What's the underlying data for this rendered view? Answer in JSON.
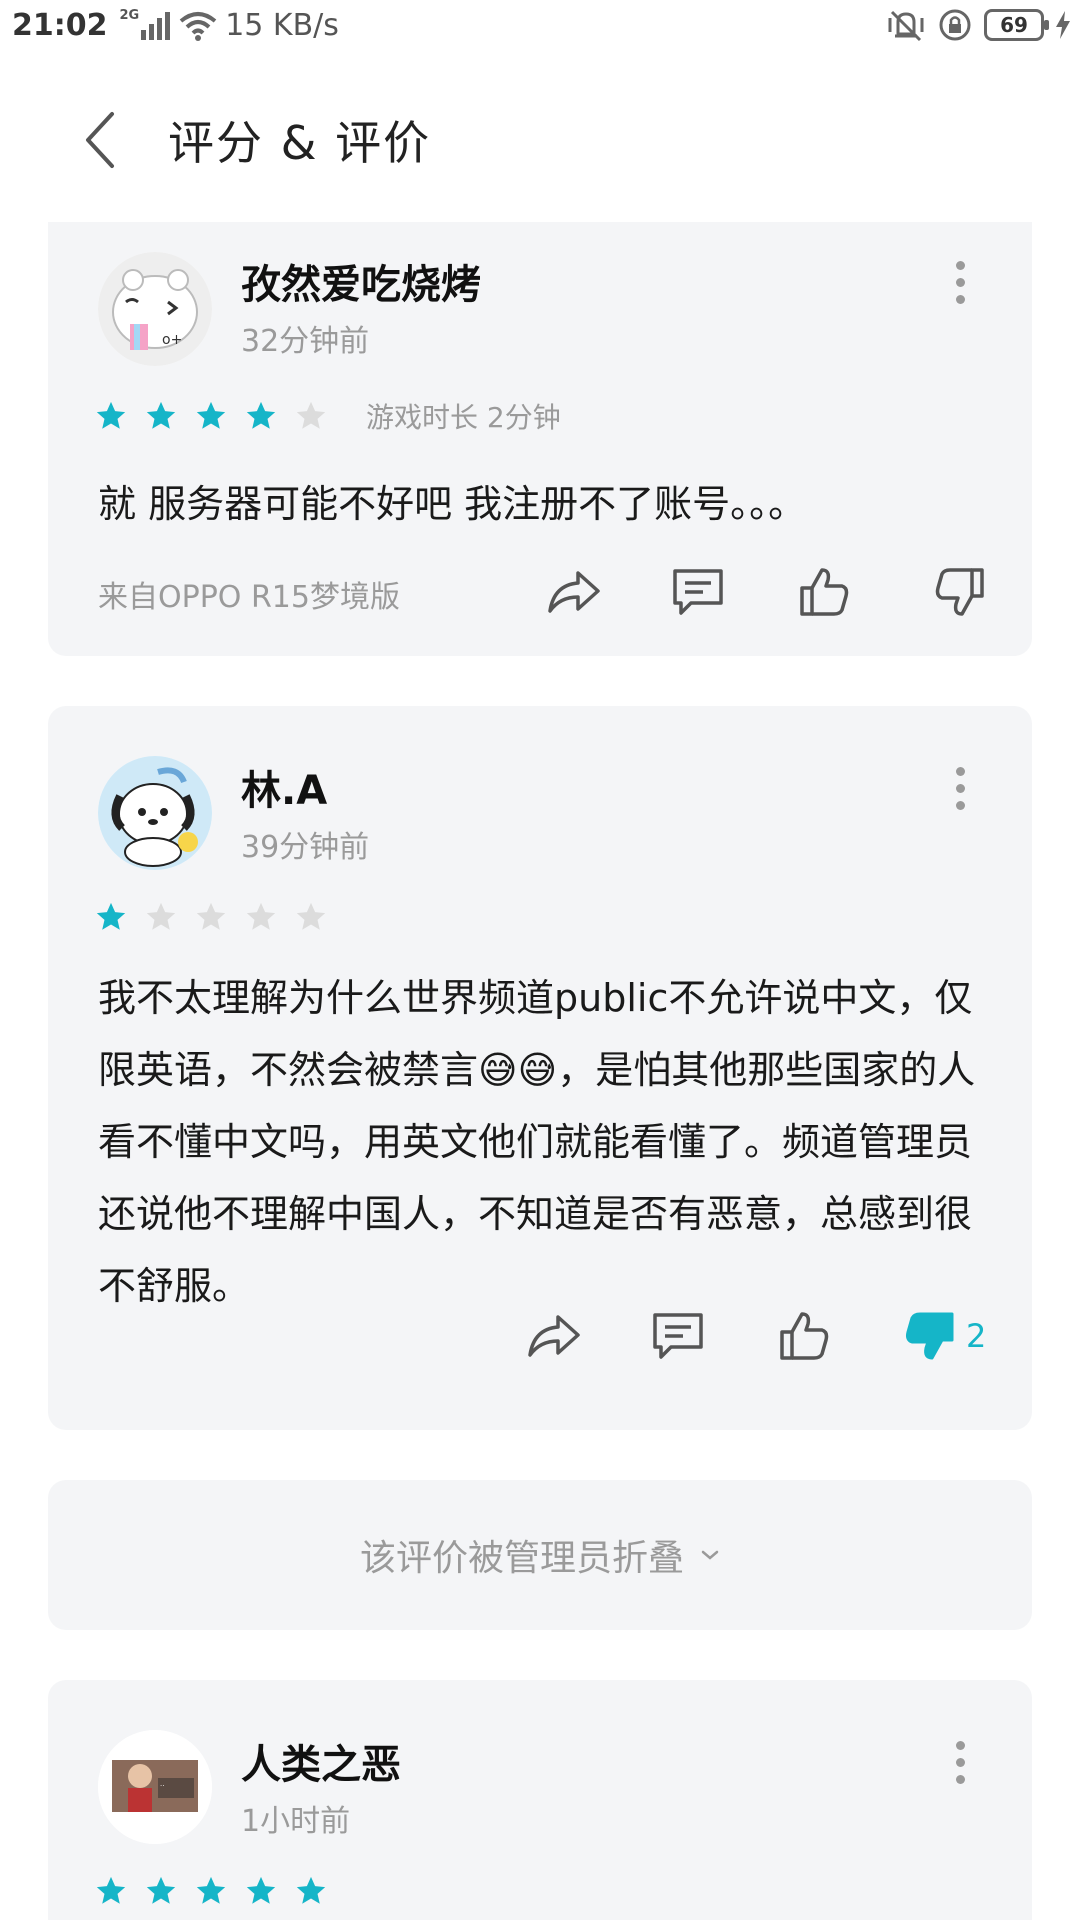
{
  "status_bar": {
    "time": "21:02",
    "network": "2G",
    "speed": "15 KB/s",
    "battery": "69"
  },
  "header": {
    "title": "评分 & 评价"
  },
  "reviews": [
    {
      "username": "孜然爱吃烧烤",
      "time_ago": "32分钟前",
      "rating": 4,
      "play_time": "游戏时长 2分钟",
      "text": "就 服务器可能不好吧 我注册不了账号。。。",
      "device": "来自OPPO R15梦境版",
      "dislike_count": ""
    },
    {
      "username": "林.A",
      "time_ago": "39分钟前",
      "rating": 1,
      "play_time": "",
      "text": "我不太理解为什么世界频道public不允许说中文，仅限英语，不然会被禁言😅😅，是怕其他那些国家的人看不懂中文吗，用英文他们就能看懂了。频道管理员还说他不理解中国人，不知道是否有恶意，总感到很不舒服。",
      "device": "",
      "dislike_count": "2"
    },
    {
      "username": "人类之恶",
      "time_ago": "1小时前",
      "rating": 5
    }
  ],
  "folded_notice": "该评价被管理员折叠",
  "colors": {
    "accent": "#15b5c8",
    "star_empty": "#dcdcdc",
    "card_bg": "#f4f5f7"
  },
  "icons": [
    "back-arrow-icon",
    "share-icon",
    "comment-icon",
    "like-icon",
    "dislike-icon",
    "more-icon",
    "chevron-down-icon"
  ]
}
